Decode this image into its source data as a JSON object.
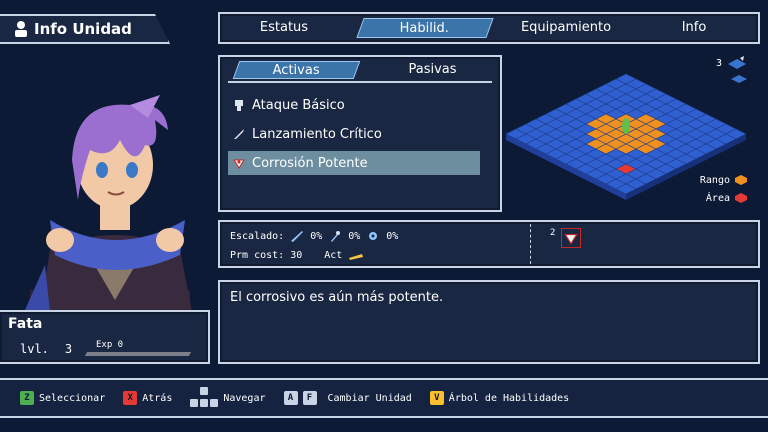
{
  "header": {
    "title": "Info Unidad"
  },
  "tabs": [
    {
      "label": "Estatus",
      "active": false
    },
    {
      "label": "Habilid.",
      "active": true
    },
    {
      "label": "Equipamiento",
      "active": false
    },
    {
      "label": "Info",
      "active": false
    }
  ],
  "subtabs": [
    {
      "label": "Activas",
      "active": true
    },
    {
      "label": "Pasivas",
      "active": false
    }
  ],
  "skills": [
    {
      "label": "Ataque Básico",
      "icon": "fist-icon",
      "selected": false
    },
    {
      "label": "Lanzamiento Crítico",
      "icon": "dagger-icon",
      "selected": false
    },
    {
      "label": "Corrosión Potente",
      "icon": "corrosion-icon",
      "selected": true
    }
  ],
  "map": {
    "height_value": "3",
    "range_label": "Rango",
    "area_label": "Área"
  },
  "stats": {
    "scaling_label": "Escalado:",
    "scaling_values": [
      "0%",
      "0%",
      "0%"
    ],
    "prm_cost_label": "Prm cost:",
    "prm_cost_value": "30",
    "act_label": "Act",
    "uses_value": "2"
  },
  "description": "El corrosivo es aún más potente.",
  "character": {
    "name": "Fata",
    "level_label": "lvl.",
    "level_value": "3",
    "exp_label": "Exp 0",
    "exp_fraction": 0.0
  },
  "controls": [
    {
      "key": "Z",
      "color": "#4caf50",
      "label": "Seleccionar"
    },
    {
      "key": "X",
      "color": "#e53935",
      "label": "Atrás"
    },
    {
      "key": "dpad",
      "color": "#c9d3e6",
      "label": "Navegar"
    },
    {
      "key": "A",
      "color": "#c9d3e6",
      "label": ""
    },
    {
      "key": "F",
      "color": "#c9d3e6",
      "label": "Cambiar Unidad"
    },
    {
      "key": "V",
      "color": "#fbc02d",
      "label": "Árbol de Habilidades"
    }
  ],
  "colors": {
    "panel_bg": "#1a2742",
    "panel_border": "#c9d3e6",
    "tab_active": "#3b74a8",
    "selection": "#6c8e9e",
    "grid_tile": "#2f5fd0",
    "range_tile": "#f0901e",
    "area_tile": "#e53935"
  }
}
